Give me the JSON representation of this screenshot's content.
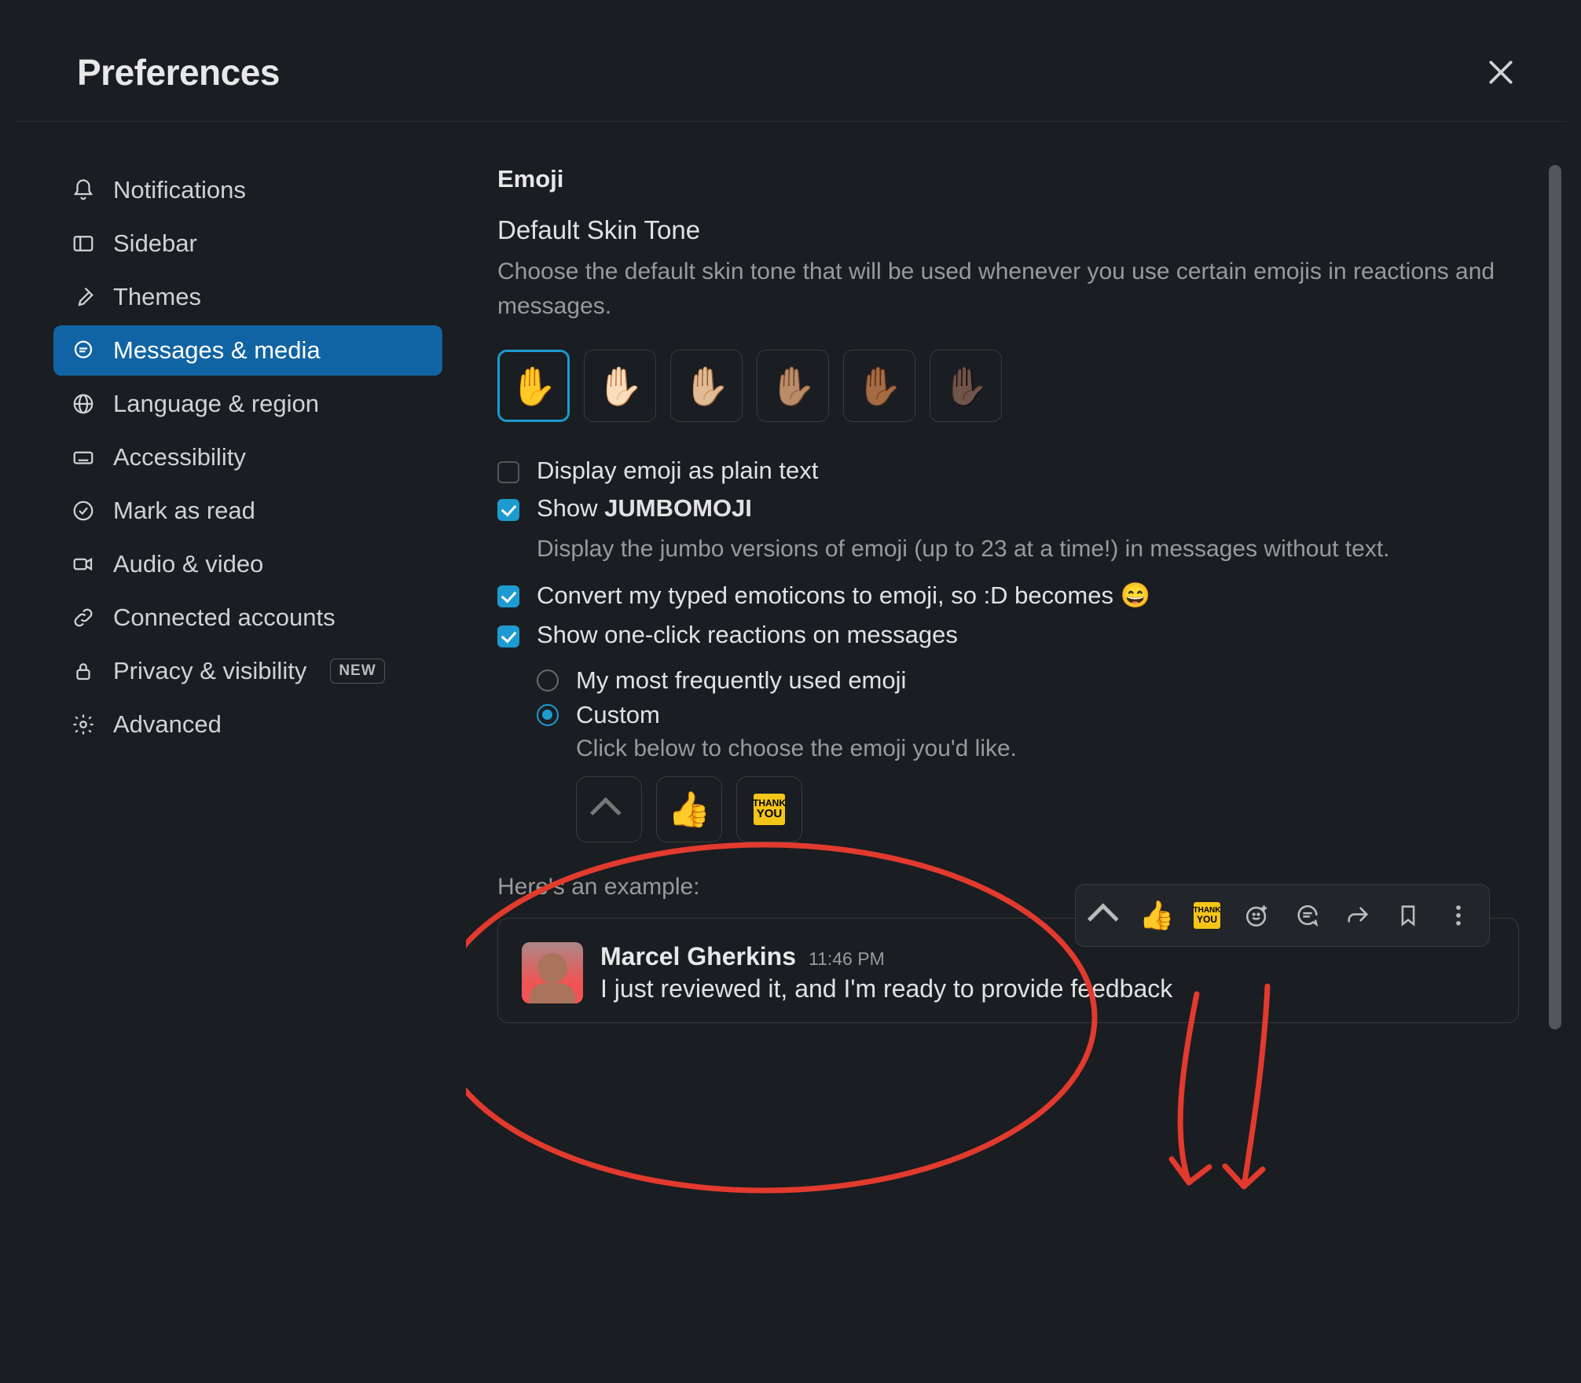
{
  "header": {
    "title": "Preferences"
  },
  "sidebar": {
    "items": [
      {
        "label": "Notifications"
      },
      {
        "label": "Sidebar"
      },
      {
        "label": "Themes"
      },
      {
        "label": "Messages & media"
      },
      {
        "label": "Language & region"
      },
      {
        "label": "Accessibility"
      },
      {
        "label": "Mark as read"
      },
      {
        "label": "Audio & video"
      },
      {
        "label": "Connected accounts"
      },
      {
        "label": "Privacy & visibility"
      },
      {
        "label": "Advanced"
      }
    ],
    "new_badge": "NEW",
    "active_index": 3
  },
  "emoji": {
    "heading": "Emoji",
    "skin_heading": "Default Skin Tone",
    "skin_help": "Choose the default skin tone that will be used whenever you use certain emojis in reactions and messages.",
    "skin_tones": [
      "✋",
      "✋🏻",
      "✋🏼",
      "✋🏽",
      "✋🏾",
      "✋🏿"
    ],
    "selected_skin": 0,
    "opts": {
      "plain_text": {
        "label": "Display emoji as plain text",
        "checked": false
      },
      "jumbomoji": {
        "label_pre": "Show ",
        "label_bold": "JUMBOMOJI",
        "desc": "Display the jumbo versions of emoji (up to 23 at a time!) in messages without text.",
        "checked": true
      },
      "convert": {
        "label": "Convert my typed emoticons to emoji, so :D becomes 😄",
        "checked": true
      },
      "oneclick": {
        "label": "Show one-click reactions on messages",
        "checked": true,
        "radio_freq": "My most frequently used emoji",
        "radio_custom": "Custom",
        "radio_selected": "custom",
        "custom_help": "Click below to choose the emoji you'd like.",
        "choices": [
          "chevron",
          "👍",
          "thankyou"
        ]
      }
    },
    "example_label": "Here's an example:",
    "example": {
      "name": "Marcel Gherkins",
      "time": "11:46 PM",
      "text": "I just reviewed it, and I'm ready to provide feedback"
    },
    "toolbar_icons": [
      "chevron",
      "👍",
      "thankyou",
      "add-reaction",
      "thread",
      "share",
      "bookmark",
      "more"
    ]
  },
  "colors": {
    "accent": "#1164a3",
    "check": "#1d9bd1",
    "annot": "#e23a2e"
  }
}
